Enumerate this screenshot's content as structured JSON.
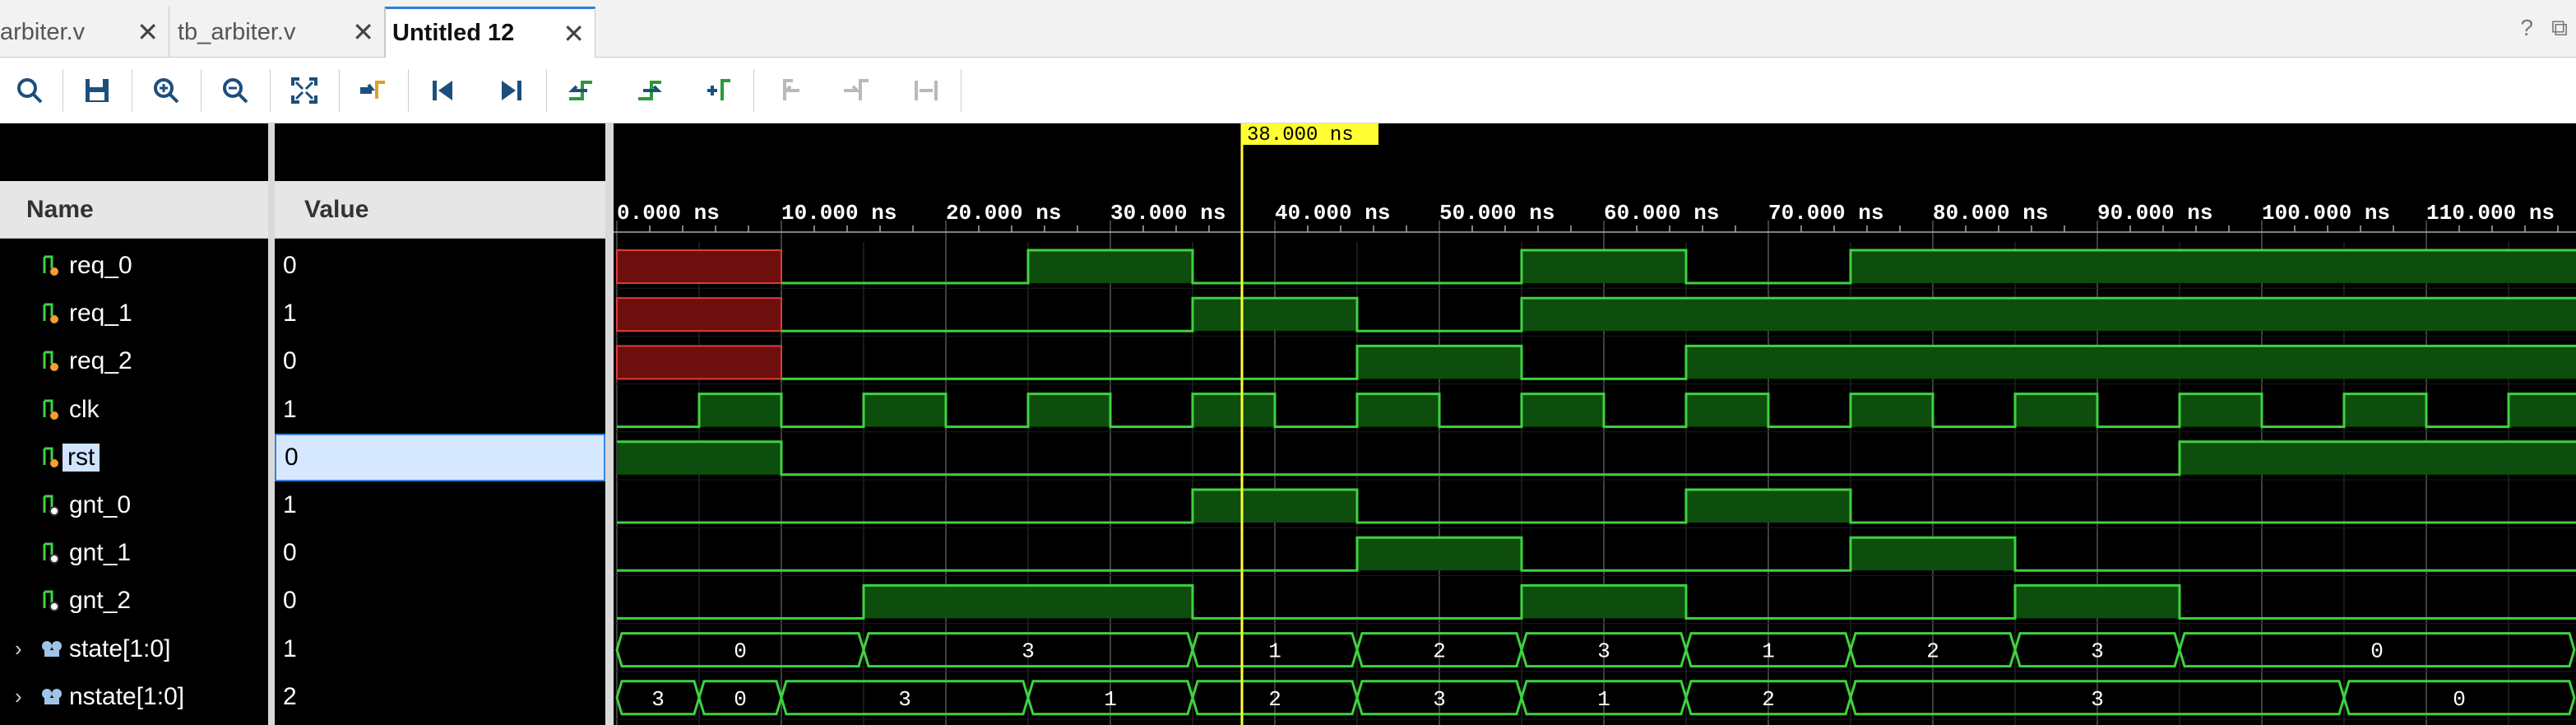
{
  "tabs": [
    {
      "label": "arbiter.v",
      "active": false
    },
    {
      "label": "tb_arbiter.v",
      "active": false
    },
    {
      "label": "Untitled 12",
      "active": true
    }
  ],
  "window_icons": [
    "?",
    "⧉"
  ],
  "toolbar": {
    "buttons": [
      "search-icon",
      "save-icon",
      "zoom-in-icon",
      "zoom-out-icon",
      "zoom-fit-icon",
      "go-to-cursor-icon",
      "go-to-start-icon",
      "go-to-end-icon",
      "previous-transition-icon",
      "next-transition-icon",
      "add-marker-icon",
      "previous-marker-icon",
      "next-marker-icon",
      "swap-cursors-icon"
    ]
  },
  "panels": {
    "name_header": "Name",
    "value_header": "Value"
  },
  "signals": [
    {
      "name": "req_0",
      "value": "0",
      "type": "input"
    },
    {
      "name": "req_1",
      "value": "1",
      "type": "input"
    },
    {
      "name": "req_2",
      "value": "0",
      "type": "input"
    },
    {
      "name": "clk",
      "value": "1",
      "type": "input"
    },
    {
      "name": "rst",
      "value": "0",
      "type": "input",
      "selected": true
    },
    {
      "name": "gnt_0",
      "value": "1",
      "type": "output"
    },
    {
      "name": "gnt_1",
      "value": "0",
      "type": "output"
    },
    {
      "name": "gnt_2",
      "value": "0",
      "type": "output"
    },
    {
      "name": "state[1:0]",
      "value": "1",
      "type": "bus"
    },
    {
      "name": "nstate[1:0]",
      "value": "2",
      "type": "bus"
    }
  ],
  "waveform": {
    "cursor_label": "38.000 ns",
    "cursor_time_ns": 38,
    "visible_start_ns": 0,
    "visible_end_ns": 119,
    "time_ticks": [
      "0.000 ns",
      "10.000 ns",
      "20.000 ns",
      "30.000 ns",
      "40.000 ns",
      "50.000 ns",
      "60.000 ns",
      "70.000 ns",
      "80.000 ns",
      "90.000 ns",
      "100.000 ns",
      "110.000 ns"
    ],
    "tick_values_ns": [
      0,
      10,
      20,
      30,
      40,
      50,
      60,
      70,
      80,
      90,
      100,
      110
    ],
    "colors": {
      "wave": "#3fd23f",
      "high_fill": "#0d4d0d",
      "undefined_fill": "#6e0f0f",
      "undefined_edge": "#e03a3a",
      "cursor": "#ffff33",
      "grid": "#555555"
    },
    "traces": [
      {
        "signal": "req_0",
        "kind": "bit",
        "undefined_until": 10,
        "transitions": [
          [
            10,
            0
          ],
          [
            25,
            1
          ],
          [
            35,
            0
          ],
          [
            55,
            1
          ],
          [
            65,
            0
          ],
          [
            75,
            1
          ]
        ]
      },
      {
        "signal": "req_1",
        "kind": "bit",
        "undefined_until": 10,
        "transitions": [
          [
            10,
            0
          ],
          [
            35,
            1
          ],
          [
            45,
            0
          ],
          [
            55,
            1
          ]
        ]
      },
      {
        "signal": "req_2",
        "kind": "bit",
        "undefined_until": 10,
        "transitions": [
          [
            10,
            0
          ],
          [
            45,
            1
          ],
          [
            55,
            0
          ],
          [
            65,
            1
          ]
        ]
      },
      {
        "signal": "clk",
        "kind": "bit",
        "transitions": [
          [
            0,
            0
          ],
          [
            5,
            1
          ],
          [
            10,
            0
          ],
          [
            15,
            1
          ],
          [
            20,
            0
          ],
          [
            25,
            1
          ],
          [
            30,
            0
          ],
          [
            35,
            1
          ],
          [
            40,
            0
          ],
          [
            45,
            1
          ],
          [
            50,
            0
          ],
          [
            55,
            1
          ],
          [
            60,
            0
          ],
          [
            65,
            1
          ],
          [
            70,
            0
          ],
          [
            75,
            1
          ],
          [
            80,
            0
          ],
          [
            85,
            1
          ],
          [
            90,
            0
          ],
          [
            95,
            1
          ],
          [
            100,
            0
          ],
          [
            105,
            1
          ],
          [
            110,
            0
          ],
          [
            115,
            1
          ]
        ]
      },
      {
        "signal": "rst",
        "kind": "bit",
        "transitions": [
          [
            0,
            1
          ],
          [
            10,
            0
          ],
          [
            95,
            1
          ]
        ]
      },
      {
        "signal": "gnt_0",
        "kind": "bit",
        "transitions": [
          [
            0,
            0
          ],
          [
            35,
            1
          ],
          [
            45,
            0
          ],
          [
            65,
            1
          ],
          [
            75,
            0
          ]
        ]
      },
      {
        "signal": "gnt_1",
        "kind": "bit",
        "transitions": [
          [
            0,
            0
          ],
          [
            45,
            1
          ],
          [
            55,
            0
          ],
          [
            75,
            1
          ],
          [
            85,
            0
          ]
        ]
      },
      {
        "signal": "gnt_2",
        "kind": "bit",
        "transitions": [
          [
            0,
            0
          ],
          [
            15,
            1
          ],
          [
            35,
            0
          ],
          [
            55,
            1
          ],
          [
            65,
            0
          ],
          [
            85,
            1
          ],
          [
            95,
            0
          ]
        ]
      },
      {
        "signal": "state[1:0]",
        "kind": "bus",
        "segments": [
          [
            0,
            15,
            "0"
          ],
          [
            15,
            35,
            "3"
          ],
          [
            35,
            45,
            "1"
          ],
          [
            45,
            55,
            "2"
          ],
          [
            55,
            65,
            "3"
          ],
          [
            65,
            75,
            "1"
          ],
          [
            75,
            85,
            "2"
          ],
          [
            85,
            95,
            "3"
          ],
          [
            95,
            119,
            "0"
          ]
        ]
      },
      {
        "signal": "nstate[1:0]",
        "kind": "bus",
        "segments": [
          [
            0,
            5,
            "3"
          ],
          [
            5,
            10,
            "0"
          ],
          [
            10,
            25,
            "3"
          ],
          [
            25,
            35,
            "1"
          ],
          [
            35,
            45,
            "2"
          ],
          [
            45,
            55,
            "3"
          ],
          [
            55,
            65,
            "1"
          ],
          [
            65,
            75,
            "2"
          ],
          [
            75,
            105,
            "3"
          ],
          [
            105,
            119,
            "0"
          ]
        ]
      }
    ]
  }
}
